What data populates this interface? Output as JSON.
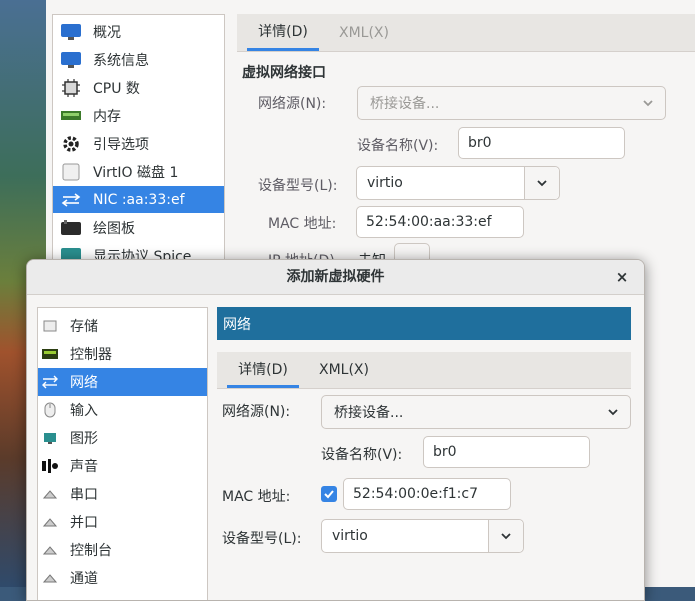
{
  "back_window": {
    "sidebar": {
      "items": [
        {
          "label": "概况",
          "icon": "monitor-icon"
        },
        {
          "label": "系统信息",
          "icon": "monitor-icon"
        },
        {
          "label": "CPU 数",
          "icon": "cpu-icon"
        },
        {
          "label": "内存",
          "icon": "memory-icon"
        },
        {
          "label": "引导选项",
          "icon": "gear-icon"
        },
        {
          "label": "VirtIO 磁盘 1",
          "icon": "disk-icon"
        },
        {
          "label": "NIC :aa:33:ef",
          "icon": "network-icon"
        },
        {
          "label": "绘图板",
          "icon": "tablet-icon"
        },
        {
          "label": "显示协议 Spice",
          "icon": "display-icon"
        }
      ],
      "selected_index": 6
    },
    "tabs": [
      "详情(D)",
      "XML(X)"
    ],
    "section_title": "虚拟网络接口",
    "network_source_label": "网络源(N):",
    "network_source_value": "桥接设备...",
    "device_name_label": "设备名称(V):",
    "device_name_value": "br0",
    "device_model_label": "设备型号(L):",
    "device_model_value": "virtio",
    "mac_label": "MAC 地址:",
    "mac_value": "52:54:00:aa:33:ef",
    "ip_label_partial": "IP 地址(D)",
    "ip_value_partial": "未知"
  },
  "dialog": {
    "title": "添加新虚拟硬件",
    "close_glyph": "×",
    "sidebar": {
      "items": [
        {
          "label": "存储",
          "icon": "storage-icon"
        },
        {
          "label": "控制器",
          "icon": "controller-icon"
        },
        {
          "label": "网络",
          "icon": "network-icon"
        },
        {
          "label": "输入",
          "icon": "mouse-icon"
        },
        {
          "label": "图形",
          "icon": "graphics-icon"
        },
        {
          "label": "声音",
          "icon": "sound-icon"
        },
        {
          "label": "串口",
          "icon": "serial-icon"
        },
        {
          "label": "并口",
          "icon": "parallel-icon"
        },
        {
          "label": "控制台",
          "icon": "console-icon"
        },
        {
          "label": "通道",
          "icon": "channel-icon"
        }
      ],
      "selected_index": 2
    },
    "banner": "网络",
    "tabs": [
      "详情(D)",
      "XML(X)"
    ],
    "network_source_label": "网络源(N):",
    "network_source_value": "桥接设备...",
    "device_name_label": "设备名称(V):",
    "device_name_value": "br0",
    "mac_label": "MAC 地址:",
    "mac_checked": true,
    "mac_value": "52:54:00:0e:f1:c7",
    "device_model_label": "设备型号(L):",
    "device_model_value": "virtio"
  },
  "colors": {
    "accent": "#3584e4",
    "banner": "#1f6f9d"
  }
}
